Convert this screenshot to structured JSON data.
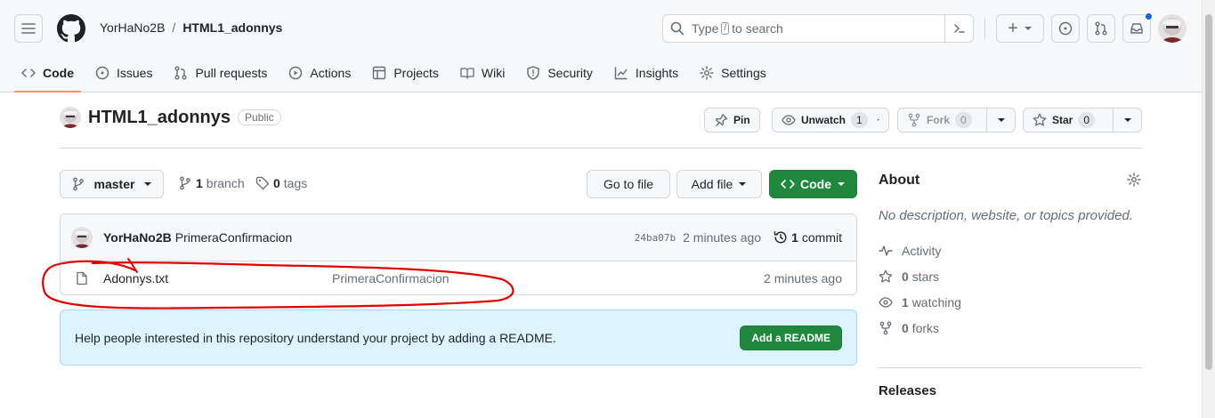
{
  "header": {
    "owner": "YorHaNo2B",
    "separator": "/",
    "repo": "HTML1_adonnys",
    "search": {
      "prefix": "Type",
      "key": "/",
      "suffix": "to search"
    },
    "create_label": "+"
  },
  "tabs": [
    {
      "label": "Code",
      "icon": "code-icon",
      "active": true
    },
    {
      "label": "Issues",
      "icon": "issue-icon"
    },
    {
      "label": "Pull requests",
      "icon": "pull-request-icon"
    },
    {
      "label": "Actions",
      "icon": "play-icon"
    },
    {
      "label": "Projects",
      "icon": "table-icon"
    },
    {
      "label": "Wiki",
      "icon": "book-icon"
    },
    {
      "label": "Security",
      "icon": "shield-icon"
    },
    {
      "label": "Insights",
      "icon": "graph-icon"
    },
    {
      "label": "Settings",
      "icon": "gear-icon"
    }
  ],
  "repo_head": {
    "name": "HTML1_adonnys",
    "visibility": "Public",
    "pin_label": "Pin",
    "watch_label": "Unwatch",
    "watch_count": "1",
    "fork_label": "Fork",
    "fork_count": "0",
    "star_label": "Star",
    "star_count": "0"
  },
  "file_nav": {
    "branch": "master",
    "branch_count": "1",
    "branch_word": "branch",
    "tag_count": "0",
    "tag_word": "tags",
    "go_to_file": "Go to file",
    "add_file": "Add file",
    "code_label": "Code"
  },
  "commit": {
    "author": "YorHaNo2B",
    "message": "PrimeraConfirmacion",
    "sha": "24ba07b",
    "age": "2 minutes ago",
    "count": "1",
    "count_word": "commit"
  },
  "files": [
    {
      "name": "Adonnys.txt",
      "message": "PrimeraConfirmacion",
      "age": "2 minutes ago"
    }
  ],
  "readme": {
    "text": "Help people interested in this repository understand your project by adding a README.",
    "button": "Add a README"
  },
  "about": {
    "title": "About",
    "description": "No description, website, or topics provided.",
    "activity": "Activity",
    "stars_count": "0",
    "stars_word": "stars",
    "watching_count": "1",
    "watching_word": "watching",
    "forks_count": "0",
    "forks_word": "forks"
  },
  "releases": {
    "title": "Releases"
  },
  "colors": {
    "accent": "#0969da",
    "primary_button": "#1f883d",
    "tab_underline": "#fd8c73",
    "annotation": "#e00000"
  }
}
